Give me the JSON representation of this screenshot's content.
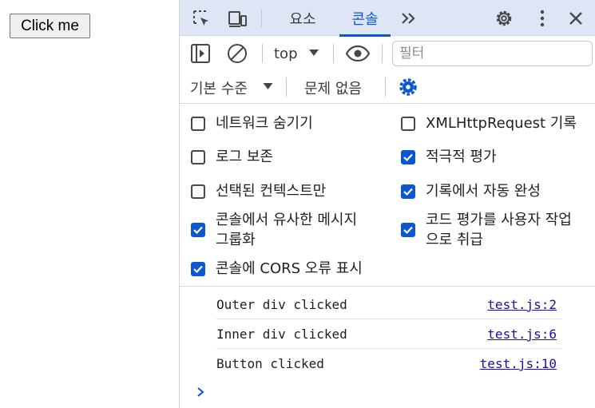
{
  "page": {
    "button_label": "Click me"
  },
  "devtools": {
    "tabs": [
      {
        "label": "요소",
        "active": false
      },
      {
        "label": "콘솔",
        "active": true
      }
    ],
    "toolbar": {
      "context_label": "top",
      "filter_placeholder": "필터",
      "level_label": "기본 수준",
      "issues_label": "문제 없음"
    },
    "settings": {
      "left": [
        {
          "label": "네트워크 숨기기",
          "checked": false
        },
        {
          "label": "로그 보존",
          "checked": false
        },
        {
          "label": "선택된 컨텍스트만",
          "checked": false
        },
        {
          "label": "콘솔에서 유사한 메시지 그룹화",
          "checked": true
        },
        {
          "label": "콘솔에 CORS 오류 표시",
          "checked": true
        }
      ],
      "right": [
        {
          "label": "XMLHttpRequest 기록",
          "checked": false
        },
        {
          "label": "적극적 평가",
          "checked": true
        },
        {
          "label": "기록에서 자동 완성",
          "checked": true
        },
        {
          "label": "코드 평가를 사용자 작업으로 취급",
          "checked": true
        }
      ]
    },
    "messages": [
      {
        "text": "Outer div clicked",
        "source": "test.js:2"
      },
      {
        "text": "Inner div clicked",
        "source": "test.js:6"
      },
      {
        "text": "Button clicked",
        "source": "test.js:10"
      }
    ]
  },
  "colors": {
    "accent": "#0b57d0",
    "tabbar_bg": "#dee5f5",
    "link": "#1a0dab"
  },
  "icons": [
    "inspect-icon",
    "device-toolbar-icon",
    "more-tabs-icon",
    "settings-gear-icon",
    "kebab-menu-icon",
    "close-icon",
    "sidebar-toggle-icon",
    "clear-console-icon",
    "dropdown-arrow-icon",
    "eye-icon",
    "console-settings-gear-icon",
    "prompt-chevron-icon"
  ]
}
